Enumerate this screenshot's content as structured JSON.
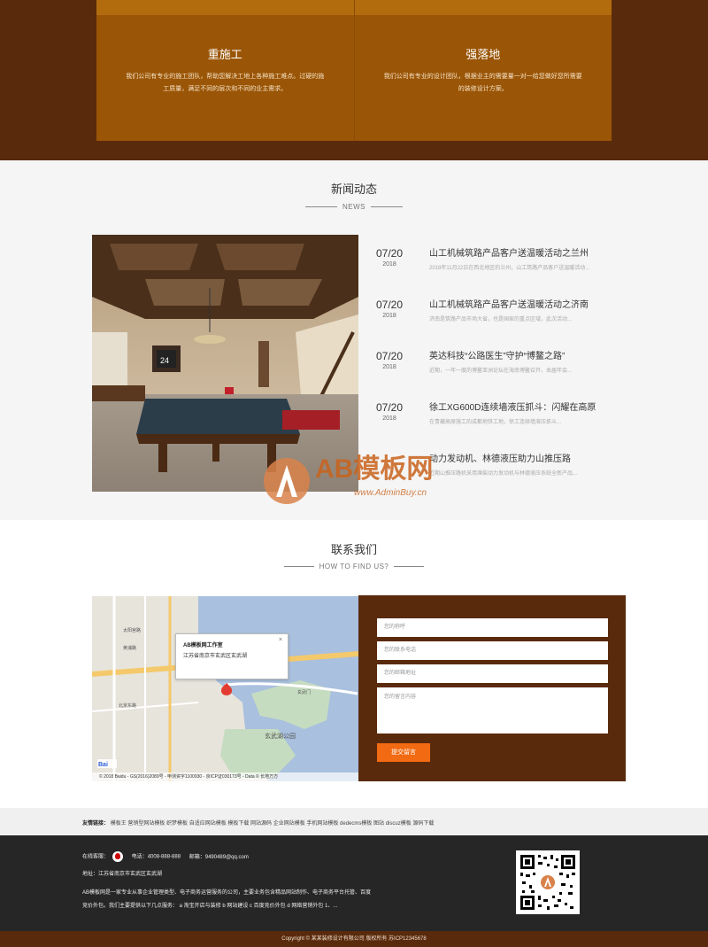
{
  "services": {
    "cards": [
      {
        "title": "重施工",
        "desc": "我们公司有专业的施工团队，帮助您解决工地上各种施工难点。过硬的施工质量，满足不同的层次和不同的业主需求。"
      },
      {
        "title": "强落地",
        "desc": "我们公司有专业的设计团队，根据业主的需要量一对一给您做好您所需要的装修设计方案。"
      }
    ]
  },
  "news": {
    "title": "新闻动态",
    "subtitle": "NEWS",
    "items": [
      {
        "date": "07/20",
        "year": "2018",
        "title": "山工机械筑路产品客户送温暖活动之兰州",
        "summary": "2018年11月22日在西北地区的兰州，山工筑路产品客户送温暖活动..."
      },
      {
        "date": "07/20",
        "year": "2018",
        "title": "山工机械筑路产品客户送温暖活动之济南",
        "summary": "济南是筑路产品市场大省，也是国家的重点区域，此次活动..."
      },
      {
        "date": "07/20",
        "year": "2018",
        "title": "英达科技“公路医生”守护“博鳌之路”",
        "summary": "近期，一年一度的博鳌亚洲论坛在海南博鳌召开，本届年会..."
      },
      {
        "date": "07/20",
        "year": "2018",
        "title": "徐工XG600D连续墙液压抓斗：闪耀在高原",
        "summary": "在青藏高原施工的成都地铁工地，徐工连续墙液压抓斗..."
      },
      {
        "date": "",
        "year": "",
        "title": "动力发动机、林德液压助力山推压路",
        "summary": "近期山推压路机采用潍柴动力发动机与林德液压系统全新产品..."
      }
    ]
  },
  "watermark": {
    "text": "AB模板网",
    "url": "www.AdminBuy.cn"
  },
  "contact": {
    "title": "联系我们",
    "subtitle": "HOW TO FIND US?",
    "map": {
      "popup_title": "AB模板网工作室",
      "popup_address": "江苏省南京市玄武区玄武湖",
      "labels": [
        "玄武湖公园",
        "太阳宫路",
        "黄浦路",
        "北京东路",
        "玄武门"
      ],
      "credit": "© 2018 Baidu - GS(2016)2089号 - 甲测资字1100930 - 京ICP证030173号 - Data © 长地万方"
    },
    "form": {
      "name_placeholder": "您的称呼",
      "phone_placeholder": "您的联系电话",
      "email_placeholder": "您的邮箱地址",
      "message_placeholder": "您的留言内容",
      "submit_label": "提交留言"
    }
  },
  "links": {
    "label": "友情链接：",
    "items": "模板王  营销型网站模板  织梦模板  自适应网站模板  模板下载  网站源码  企业网站模板  手机网站模板  dedecms模板  图站  discuz模板  源码下载"
  },
  "footer": {
    "qq_label": "在线客服：",
    "phone": "电话：4008-888-888",
    "email": "邮箱：9490489@qq.com",
    "address": "地址：江苏省南京市玄武区玄武湖",
    "about": "AB模板网是一家专业从事企业管理类型、电子商务运营服务的公司，主要业务包含精品网站制作、电子商务平台托管、百度竞价外包。我们主要提供以下几点服务： a 淘宝开店与装修  b 网站建设  c 百度竞价外包  d 网络营销外包  1、..."
  },
  "copyright": "Copyright © 某某装修设计有限公司 版权所有   苏ICP12345678"
}
